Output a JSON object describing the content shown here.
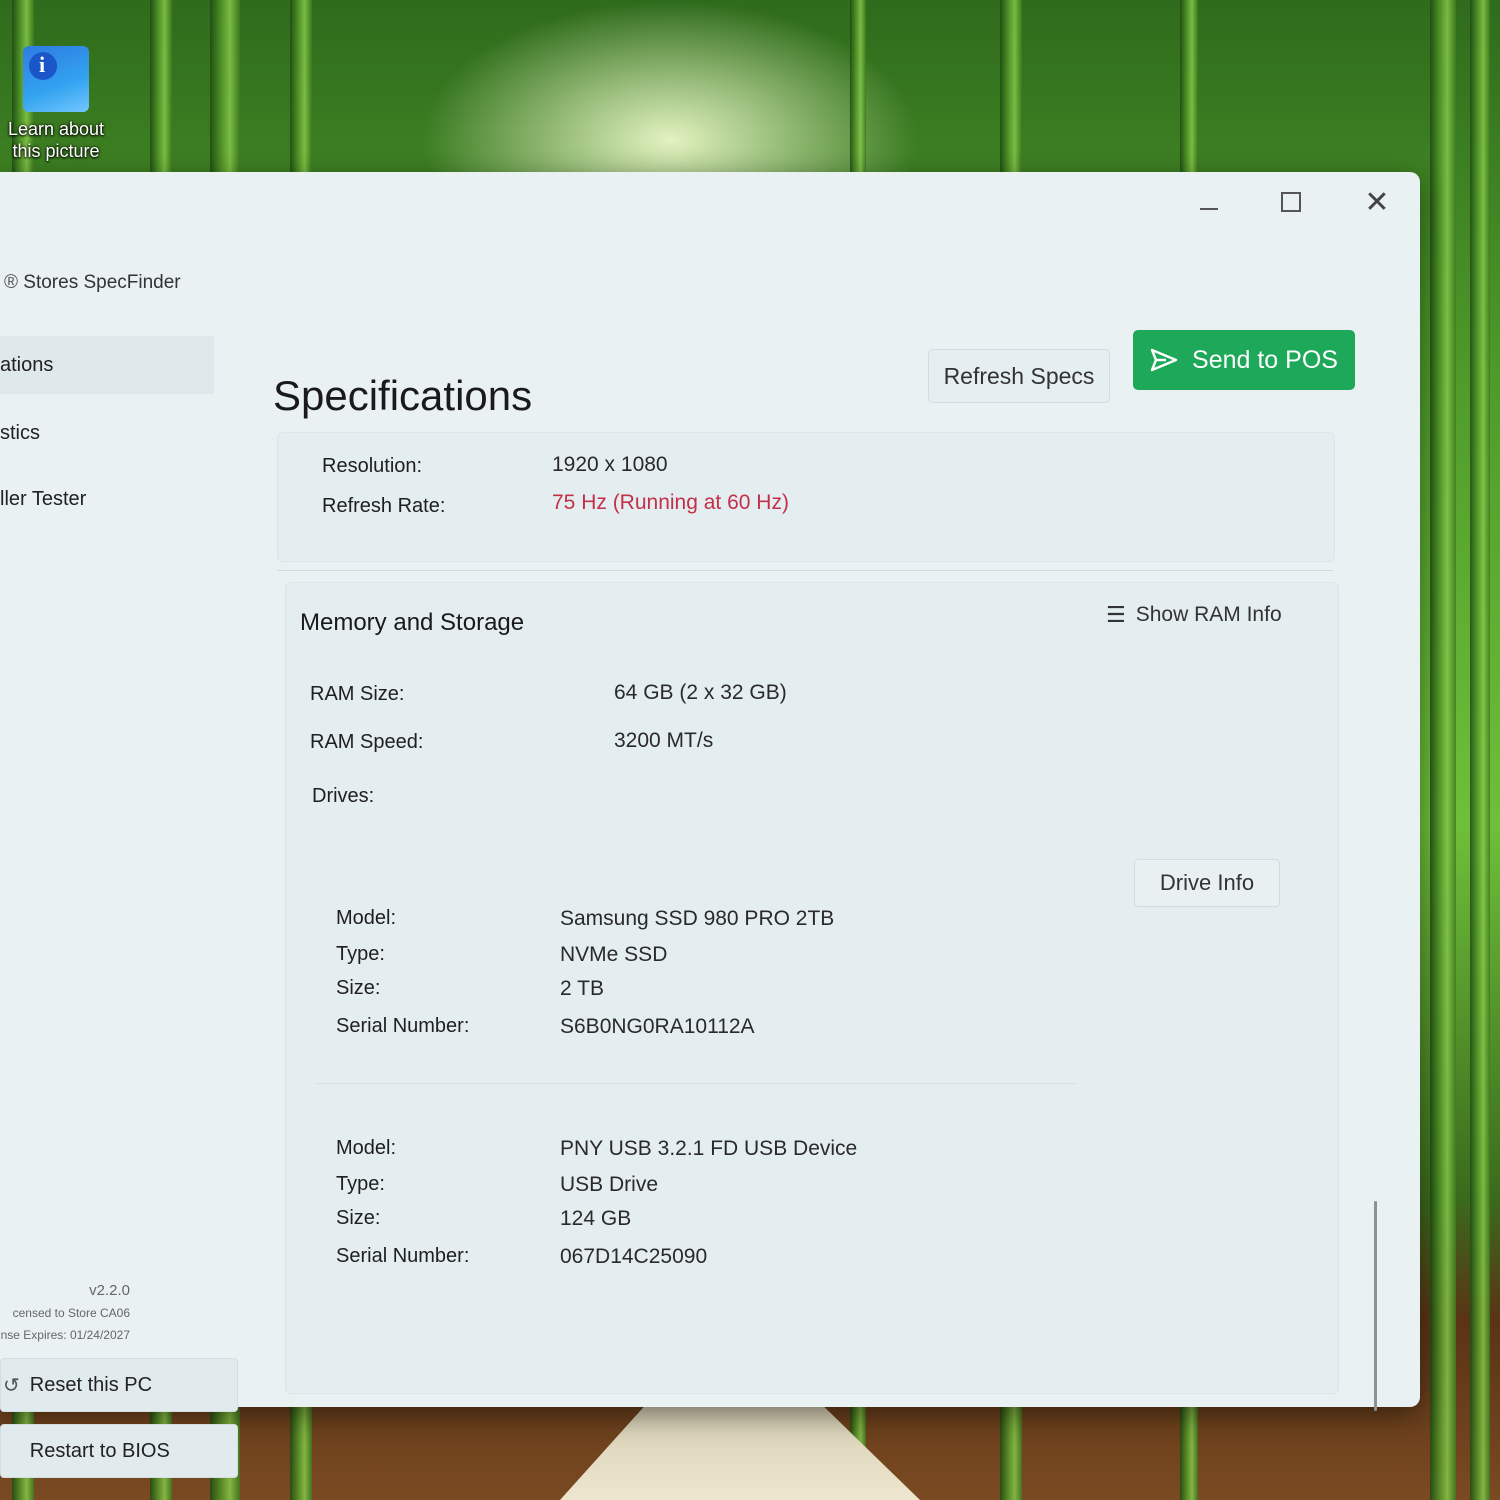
{
  "desktop": {
    "icon_label_line1": "Learn about",
    "icon_label_line2": "this picture"
  },
  "window": {
    "title": "Stores SpecFinder",
    "controls": {
      "minimize": "—",
      "maximize": "☐",
      "close": "✕"
    }
  },
  "sidebar": {
    "items": [
      {
        "label": "ations"
      },
      {
        "label": "stics"
      },
      {
        "label": "ller Tester"
      }
    ],
    "version": "v2.2.0",
    "license": "censed to Store CA06",
    "expires": "nse Expires: 01/24/2027",
    "reset_label": "Reset this PC",
    "bios_label": "Restart to BIOS"
  },
  "main": {
    "title": "Specifications",
    "refresh_label": "Refresh Specs",
    "send_label": "Send to POS",
    "display": {
      "resolution_label": "Resolution:",
      "resolution_value": "1920 x 1080",
      "refresh_label": "Refresh Rate:",
      "refresh_value": "75 Hz (Running at 60 Hz)"
    },
    "memory": {
      "title": "Memory and Storage",
      "show_ram_label": "Show RAM Info",
      "ram_size_label": "RAM Size:",
      "ram_size_value": "64 GB (2 x 32 GB)",
      "ram_speed_label": "RAM Speed:",
      "ram_speed_value": "3200 MT/s",
      "drives_label": "Drives:",
      "drive_info_label": "Drive Info",
      "field_labels": {
        "model": "Model:",
        "type": "Type:",
        "size": "Size:",
        "serial": "Serial Number:"
      },
      "drives": [
        {
          "model": "Samsung SSD 980 PRO 2TB",
          "type": "NVMe SSD",
          "size": "2 TB",
          "serial": "S6B0NG0RA10112A"
        },
        {
          "model": "PNY USB 3.2.1 FD USB Device",
          "type": "USB Drive",
          "size": "124 GB",
          "serial": "067D14C25090"
        }
      ]
    }
  },
  "colors": {
    "accent": "#1ea85a",
    "warning": "#c4304a",
    "window_bg": "#e9f1f2"
  }
}
